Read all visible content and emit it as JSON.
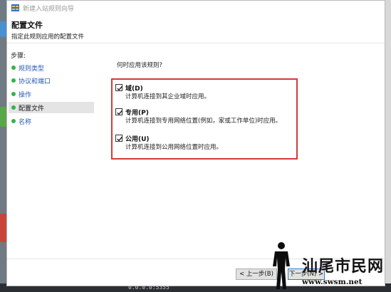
{
  "window": {
    "title": "新建入站规则向导",
    "header_title": "配置文件",
    "header_subtitle": "指定此规则应用的配置文件"
  },
  "sidebar": {
    "steps_label": "步骤:",
    "items": [
      {
        "label": "规则类型",
        "active": false
      },
      {
        "label": "协议和端口",
        "active": false
      },
      {
        "label": "操作",
        "active": false
      },
      {
        "label": "配置文件",
        "active": true
      },
      {
        "label": "名称",
        "active": false
      }
    ]
  },
  "content": {
    "question": "何时应用该规则?",
    "options": [
      {
        "title": "域(D)",
        "description": "计算机连接到其企业域时应用。",
        "checked": true
      },
      {
        "title": "专用(P)",
        "description": "计算机连接到专用网络位置(例如，家或工作单位)时应用。",
        "checked": true
      },
      {
        "title": "公用(U)",
        "description": "计算机连接到公用网络位置时应用。",
        "checked": true
      }
    ]
  },
  "buttons": {
    "back_label": "< 上一步(B)",
    "next_label": "下一步(N) >"
  },
  "taskbar": {
    "text": "0.0.0.0:5355"
  },
  "watermark": {
    "logo_text": "汕尾市民网",
    "url": "www.swsm.net"
  },
  "colors": {
    "highlight_border": "#d23a3a",
    "nav_link": "#2a5bb5",
    "nav_bullet": "#35b34a"
  }
}
